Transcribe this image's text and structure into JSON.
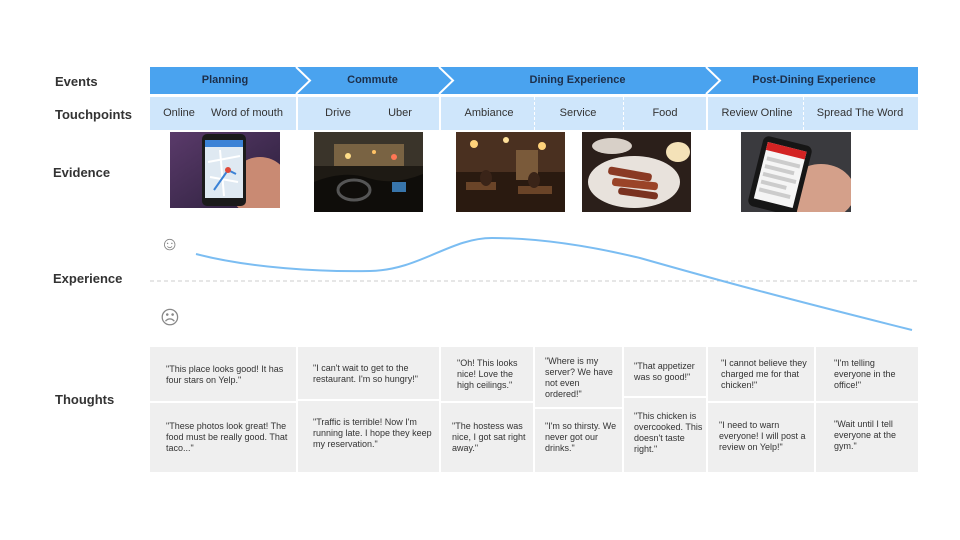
{
  "labels": {
    "events": "Events",
    "touchpoints": "Touchpoints",
    "evidence": "Evidence",
    "experience": "Experience",
    "thoughts": "Thoughts"
  },
  "events": [
    "Planning",
    "Commute",
    "Dining Experience",
    "Post-Dining Experience"
  ],
  "touchpoints": [
    "Online",
    "Word of mouth",
    "Drive",
    "Uber",
    "Ambiance",
    "Service",
    "Food",
    "Review Online",
    "Spread The Word"
  ],
  "icons": {
    "happy": "smiley-face-icon",
    "sad": "frowning-face-icon"
  },
  "colors": {
    "event_bar": "#4aa3ef",
    "touchpoint_bar": "#cfe6fb",
    "curve": "#7bbdf2",
    "thought_bg": "#efefef"
  },
  "thoughts": {
    "top": [
      "\"This place looks good! It has four stars on Yelp.\"",
      "\"I can't wait to get to the restaurant. I'm so hungry!\"",
      "\"Oh! This looks nice! Love the high ceilings.\"",
      "\"Where is my server? We have not even ordered!\"",
      "\"That appetizer was so good!\"",
      "\"I cannot believe they charged me for that chicken!\"",
      "\"I'm telling everyone in the office!\""
    ],
    "bottom": [
      "\"These photos look great! The food must be really good. That taco...\"",
      "\"Traffic is terrible! Now I'm running late. I hope they keep my reservation.\"",
      "\"The hostess was nice, I got sat right away.\"",
      "\"I'm so thirsty. We never got our drinks.\"",
      "\"This chicken is overcooked. This doesn't taste right.\"",
      "\"I need to warn everyone! I will post a review on Yelp!\"",
      "\"Wait until I tell everyone at the gym.\""
    ]
  }
}
